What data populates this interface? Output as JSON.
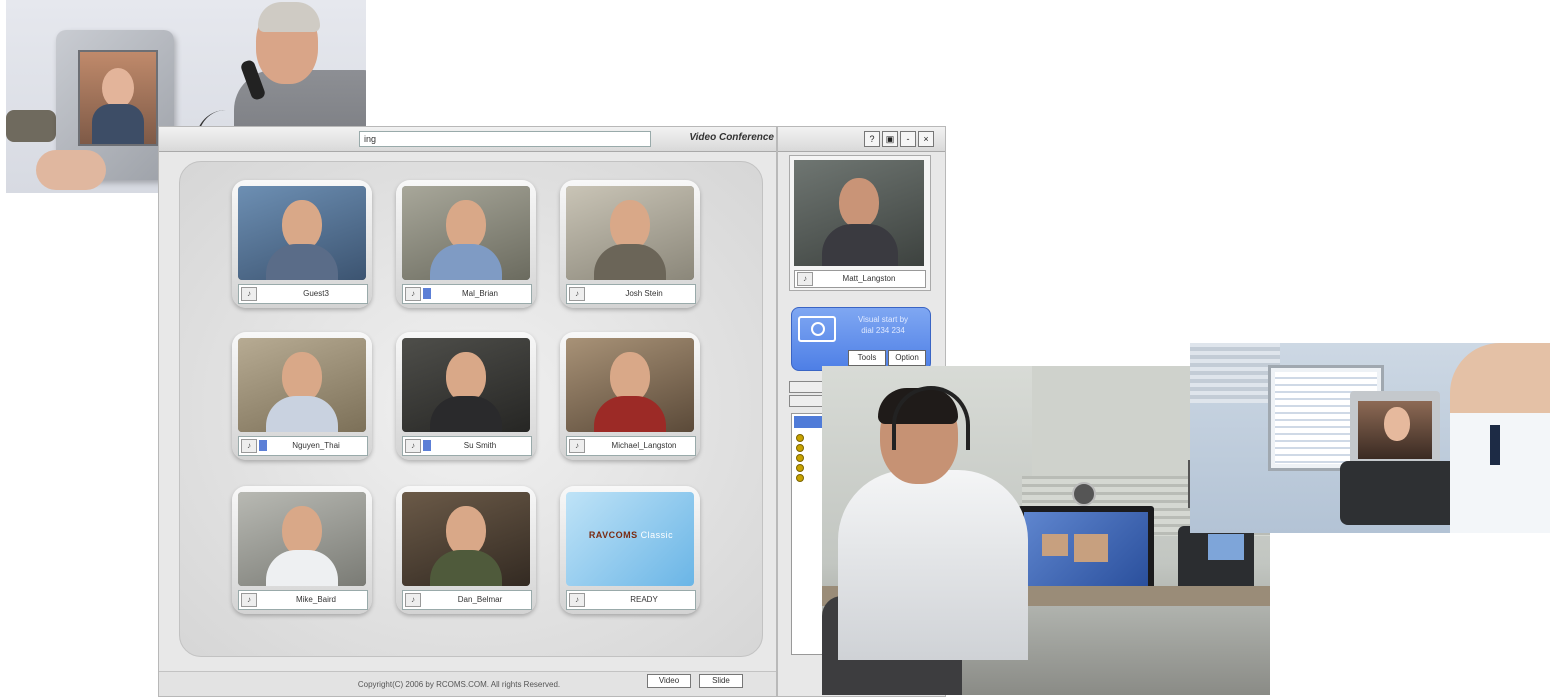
{
  "app": {
    "url": "ing",
    "title": "Video Conference",
    "window_buttons": [
      "?",
      "▣",
      "-",
      "×"
    ],
    "participants": [
      {
        "name": "Guest3",
        "level": 0
      },
      {
        "name": "Mal_Brian",
        "level": 0
      },
      {
        "name": "Josh Stein",
        "level": 0
      },
      {
        "name": "Nguyen_Thai",
        "level": 1
      },
      {
        "name": "Su Smith",
        "level": 1
      },
      {
        "name": "Michael_Langston",
        "level": 0
      },
      {
        "name": "Mike_Baird",
        "level": 0
      },
      {
        "name": "Dan_Belmar",
        "level": 0
      }
    ],
    "ready_tile": {
      "logo": "RAVCOMS",
      "logo_sub": "Classic",
      "status": "READY"
    },
    "side_preview_name": "Matt_Langston",
    "blue_panel": {
      "line1": "Visual start by",
      "line2": "dial 234 234",
      "btn_left": "Tools",
      "btn_right": "Option"
    },
    "copyright": "Copyright(C) 2006 by RCOMS.COM. All rights Reserved.",
    "footer_buttons": [
      "Video",
      "Slide"
    ],
    "speaker_icon": "speaker-icon"
  }
}
